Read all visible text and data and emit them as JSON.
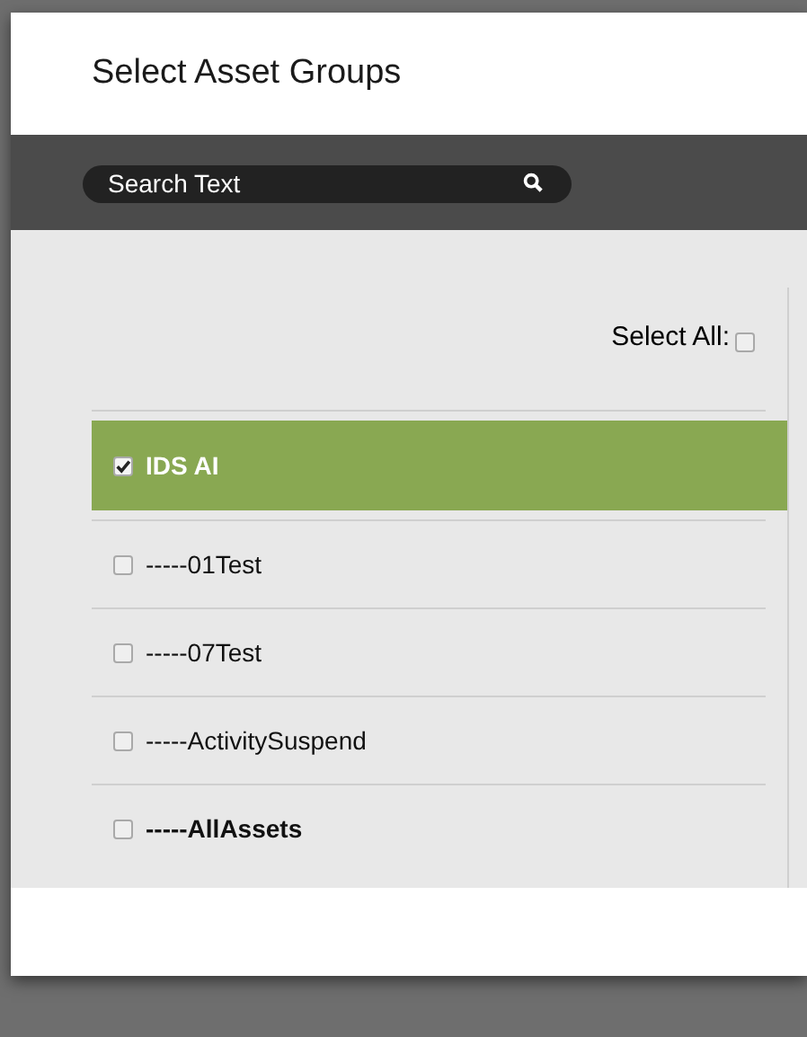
{
  "dialog": {
    "title": "Select Asset Groups"
  },
  "search": {
    "placeholder": "Search Text"
  },
  "select_all": {
    "label": "Select All:",
    "checked": false
  },
  "groups": [
    {
      "name": "IDS AI",
      "checked": true,
      "selected": true,
      "bold": true
    },
    {
      "name": "-----01Test",
      "checked": false,
      "selected": false,
      "bold": false
    },
    {
      "name": "-----07Test",
      "checked": false,
      "selected": false,
      "bold": false
    },
    {
      "name": "-----ActivitySuspend",
      "checked": false,
      "selected": false,
      "bold": false
    },
    {
      "name": "-----AllAssets",
      "checked": false,
      "selected": false,
      "bold": true
    }
  ]
}
